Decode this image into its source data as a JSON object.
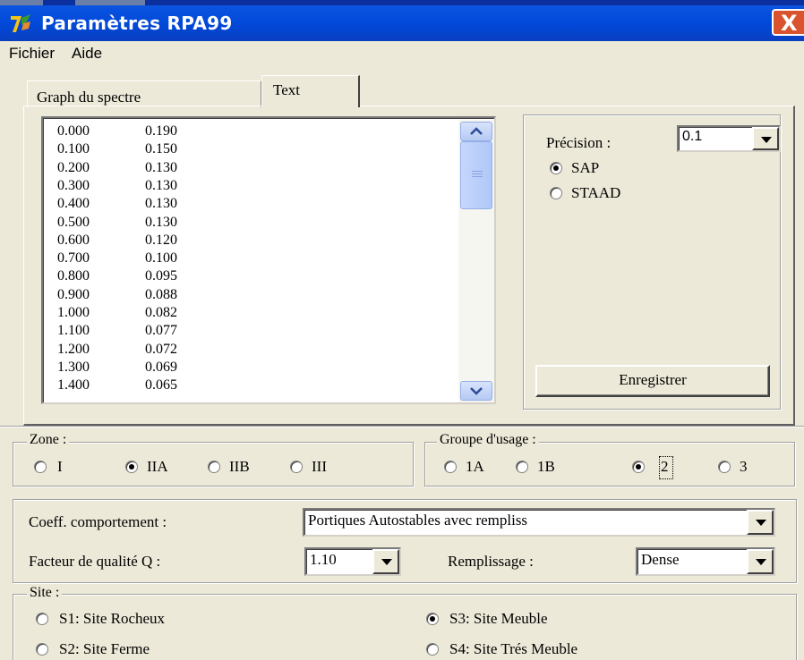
{
  "window": {
    "title": "Paramètres RPA99",
    "close_glyph": "X",
    "icon": "app-logo-icon"
  },
  "menu": {
    "items": [
      "Fichier",
      "Aide"
    ]
  },
  "tabs": [
    {
      "label": "Graph du spectre",
      "active": false
    },
    {
      "label": "Text",
      "active": true
    }
  ],
  "spectrum_list": {
    "rows": [
      [
        "0.000",
        "0.190"
      ],
      [
        "0.100",
        "0.150"
      ],
      [
        "0.200",
        "0.130"
      ],
      [
        "0.300",
        "0.130"
      ],
      [
        "0.400",
        "0.130"
      ],
      [
        "0.500",
        "0.130"
      ],
      [
        "0.600",
        "0.120"
      ],
      [
        "0.700",
        "0.100"
      ],
      [
        "0.800",
        "0.095"
      ],
      [
        "0.900",
        "0.088"
      ],
      [
        "1.000",
        "0.082"
      ],
      [
        "1.100",
        "0.077"
      ],
      [
        "1.200",
        "0.072"
      ],
      [
        "1.300",
        "0.069"
      ],
      [
        "1.400",
        "0.065"
      ]
    ]
  },
  "export": {
    "precision_label": "Précision :",
    "precision_value": "0.1",
    "options": [
      {
        "label": "SAP",
        "checked": true
      },
      {
        "label": "STAAD",
        "checked": false
      }
    ],
    "save_label": "Enregistrer"
  },
  "zone": {
    "title": "Zone :",
    "options": [
      {
        "label": "I",
        "checked": false
      },
      {
        "label": "IIA",
        "checked": true
      },
      {
        "label": "IIB",
        "checked": false
      },
      {
        "label": "III",
        "checked": false
      }
    ]
  },
  "usage_group": {
    "title": "Groupe d'usage :",
    "options": [
      {
        "label": "1A",
        "checked": false
      },
      {
        "label": "1B",
        "checked": false
      },
      {
        "label": "2",
        "checked": true
      },
      {
        "label": "3",
        "checked": false
      }
    ]
  },
  "params": {
    "coeff_label": "Coeff. comportement :",
    "coeff_value": "Portiques  Autostables avec rempliss",
    "quality_label": "Facteur de qualité Q :",
    "quality_value": "1.10",
    "fill_label": "Remplissage :",
    "fill_value": "Dense"
  },
  "site": {
    "title": "Site :",
    "options": [
      {
        "label": "S1: Site Rocheux",
        "checked": false
      },
      {
        "label": "S3: Site Meuble",
        "checked": true
      },
      {
        "label": "S2: Site Ferme",
        "checked": false
      },
      {
        "label": "S4: Site Trés Meuble",
        "checked": false
      }
    ]
  },
  "colors": {
    "titlebar": "#0148d8",
    "close": "#d8532e",
    "face": "#ece9d8"
  }
}
